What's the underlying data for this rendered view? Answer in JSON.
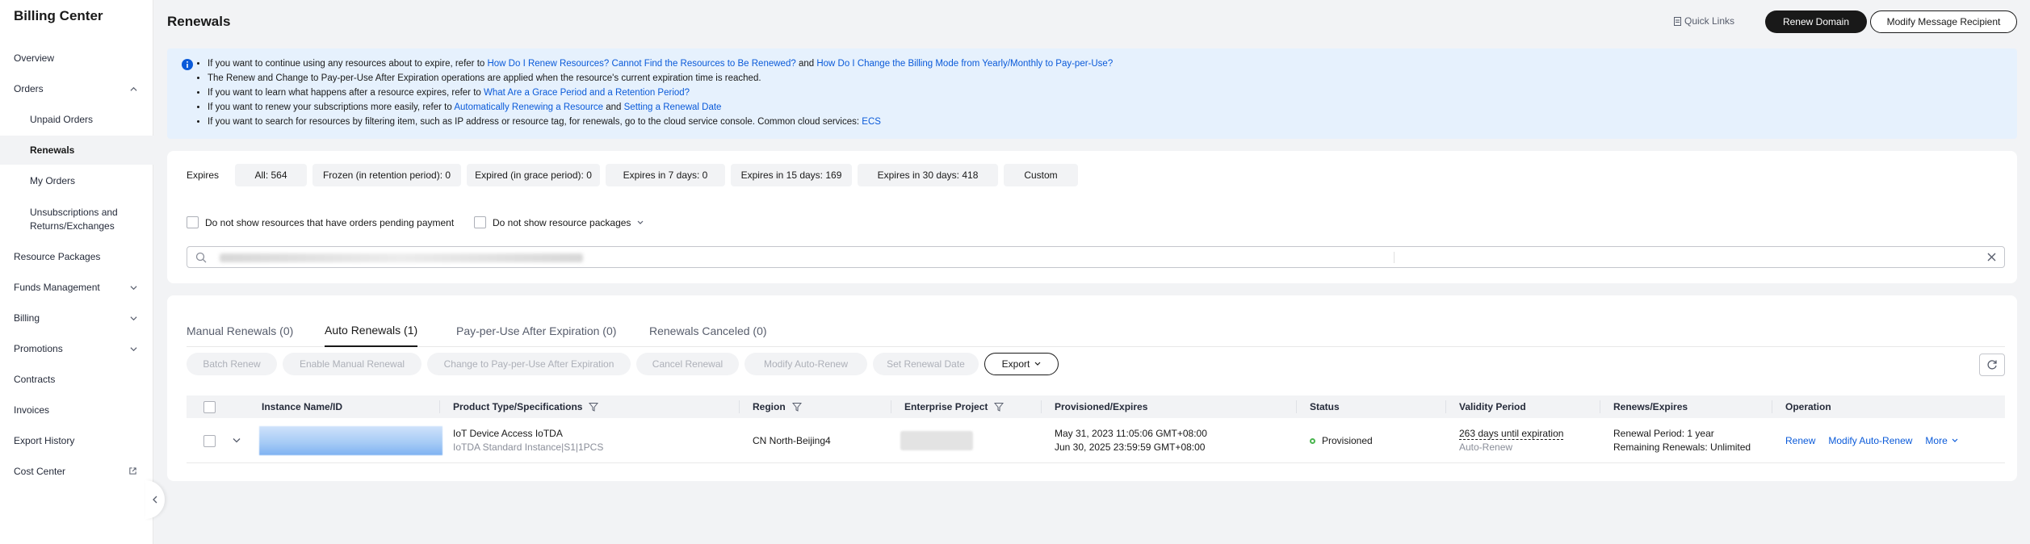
{
  "sidebar": {
    "title": "Billing Center",
    "items": [
      {
        "label": "Overview"
      },
      {
        "label": "Orders"
      },
      {
        "label": "Unpaid Orders"
      },
      {
        "label": "Renewals"
      },
      {
        "label": "My Orders"
      },
      {
        "label": "Unsubscriptions and",
        "label2": "Returns/Exchanges"
      },
      {
        "label": "Resource Packages"
      },
      {
        "label": "Funds Management"
      },
      {
        "label": "Billing"
      },
      {
        "label": "Promotions"
      },
      {
        "label": "Contracts"
      },
      {
        "label": "Invoices"
      },
      {
        "label": "Export History"
      },
      {
        "label": "Cost Center"
      }
    ]
  },
  "header": {
    "title": "Renewals",
    "quick_links": "Quick Links",
    "renew_domain": "Renew Domain",
    "modify_recipient": "Modify Message Recipient"
  },
  "notice": {
    "l1a": "If you want to continue using any resources about to expire, refer to ",
    "l1b": "How Do I Renew Resources? Cannot Find the Resources to Be Renewed?",
    "l1c": " and ",
    "l1d": "How Do I Change the Billing Mode from Yearly/Monthly to Pay-per-Use?",
    "l2": "The Renew and Change to Pay-per-Use After Expiration operations are applied when the resource's current expiration time is reached.",
    "l3a": "If you want to learn what happens after a resource expires, refer to ",
    "l3b": "What Are a Grace Period and a Retention Period?",
    "l4a": "If you want to renew your subscriptions more easily, refer to ",
    "l4b": "Automatically Renewing a Resource",
    "l4c": " and ",
    "l4d": "Setting a Renewal Date",
    "l5a": "If you want to search for resources by filtering item, such as IP address or resource tag, for renewals, go to the cloud service console. Common cloud services: ",
    "l5b": "ECS"
  },
  "filters": {
    "expires_label": "Expires",
    "buttons": [
      "All: 564",
      "Frozen (in retention period): 0",
      "Expired (in grace period): 0",
      "Expires in 7 days: 0",
      "Expires in 15 days: 169",
      "Expires in 30 days: 418",
      "Custom"
    ],
    "hide_pending": "Do not show resources that have orders pending payment",
    "hide_packages": "Do not show resource packages"
  },
  "tabs": [
    "Manual Renewals (0)",
    "Auto Renewals (1)",
    "Pay-per-Use After Expiration (0)",
    "Renewals Canceled (0)"
  ],
  "toolbar": {
    "buttons": [
      "Batch Renew",
      "Enable Manual Renewal",
      "Change to Pay-per-Use After Expiration",
      "Cancel Renewal",
      "Modify Auto-Renew",
      "Set Renewal Date"
    ],
    "export": "Export"
  },
  "table": {
    "columns": [
      "Instance Name/ID",
      "Product Type/Specifications",
      "Region",
      "Enterprise Project",
      "Provisioned/Expires",
      "Status",
      "Validity Period",
      "Renews/Expires",
      "Operation"
    ],
    "rows": [
      {
        "product": "IoT Device Access IoTDA",
        "spec": "IoTDA Standard Instance|S1|1PCS",
        "region": "CN North-Beijing4",
        "provisioned": "May 31, 2023 11:05:06 GMT+08:00",
        "expires": "Jun 30, 2025 23:59:59 GMT+08:00",
        "status": "Provisioned",
        "validity": "263 days until expiration",
        "validity_sub": "Auto-Renew",
        "renew_period": "Renewal Period: 1 year",
        "remaining": "Remaining Renewals: Unlimited",
        "op_renew": "Renew",
        "op_modify": "Modify Auto-Renew",
        "op_more": "More"
      }
    ]
  },
  "colors": {
    "accent": "#0a5ad9",
    "primary_button": "#191919",
    "notice_bg": "#e6f1fd",
    "status_ok": "#4ab54f"
  }
}
